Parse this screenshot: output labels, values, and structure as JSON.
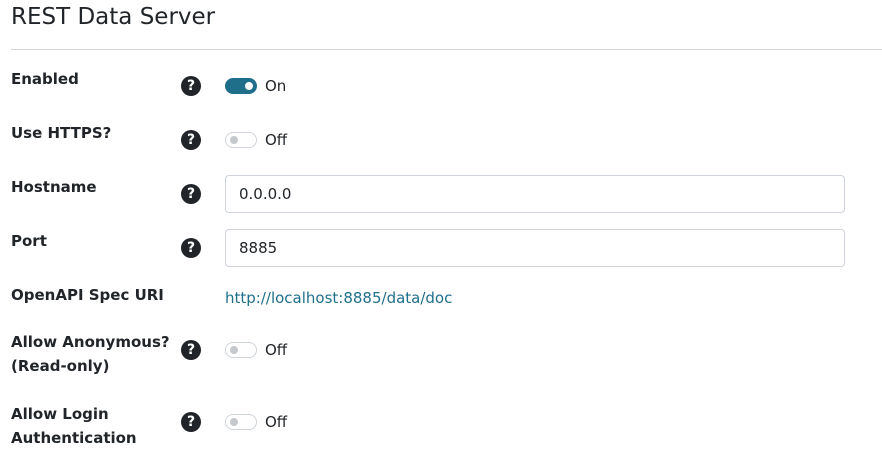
{
  "page": {
    "title": "REST Data Server"
  },
  "colors": {
    "accent": "#1f6f8b",
    "text": "#212529",
    "divider": "#d3d3d3"
  },
  "fields": {
    "enabled": {
      "label": "Enabled",
      "help_icon": "question-circle-icon",
      "help_glyph": "?",
      "state": "On",
      "checked": true
    },
    "use_https": {
      "label": "Use HTTPS?",
      "help_icon": "question-circle-icon",
      "help_glyph": "?",
      "state": "Off",
      "checked": false
    },
    "hostname": {
      "label": "Hostname",
      "help_icon": "question-circle-icon",
      "help_glyph": "?",
      "value": "0.0.0.0"
    },
    "port": {
      "label": "Port",
      "help_icon": "question-circle-icon",
      "help_glyph": "?",
      "value": "8885"
    },
    "openapi": {
      "label": "OpenAPI Spec URI",
      "link_text": "http://localhost:8885/data/doc"
    },
    "allow_anonymous": {
      "label_line1": "Allow Anonymous?",
      "label_line2": "(Read-only)",
      "help_icon": "question-circle-icon",
      "help_glyph": "?",
      "state": "Off",
      "checked": false
    },
    "allow_login": {
      "label_line1": "Allow Login",
      "label_line2": "Authentication",
      "help_icon": "question-circle-icon",
      "help_glyph": "?",
      "state": "Off",
      "checked": false
    }
  }
}
